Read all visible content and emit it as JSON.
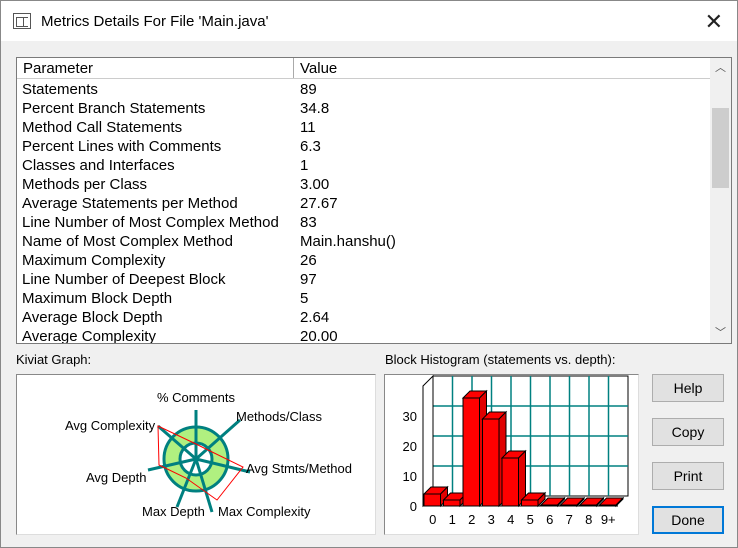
{
  "window": {
    "title": "Metrics Details For File 'Main.java'",
    "close": "✕"
  },
  "table": {
    "headers": [
      "Parameter",
      "Value"
    ],
    "rows": [
      [
        "Statements",
        "89"
      ],
      [
        "Percent Branch Statements",
        "34.8"
      ],
      [
        "Method Call Statements",
        "11"
      ],
      [
        "Percent Lines with Comments",
        "6.3"
      ],
      [
        "Classes and Interfaces",
        "1"
      ],
      [
        "Methods per Class",
        "3.00"
      ],
      [
        "Average Statements per Method",
        "27.67"
      ],
      [
        "Line Number of Most Complex Method",
        "83"
      ],
      [
        "Name of Most Complex Method",
        "Main.hanshu()"
      ],
      [
        "Maximum Complexity",
        "26"
      ],
      [
        "Line Number of Deepest Block",
        "97"
      ],
      [
        "Maximum Block Depth",
        "5"
      ],
      [
        "Average Block Depth",
        "2.64"
      ],
      [
        "Average Complexity",
        "20.00"
      ]
    ]
  },
  "kiviat": {
    "label": "Kiviat Graph:",
    "axes": [
      "% Comments",
      "Methods/Class",
      "Avg Stmts/Method",
      "Max Complexity",
      "Max Depth",
      "Avg Depth",
      "Avg Complexity"
    ]
  },
  "chart_data": {
    "type": "bar",
    "title": "Block Histogram (statements vs. depth):",
    "categories": [
      "0",
      "1",
      "2",
      "3",
      "4",
      "5",
      "6",
      "7",
      "8",
      "9+"
    ],
    "values": [
      4,
      2,
      36,
      29,
      16,
      2,
      0,
      0,
      0,
      0
    ],
    "yticks": [
      "0",
      "10",
      "20",
      "30"
    ],
    "ylim": [
      0,
      40
    ],
    "color": "#ff0000"
  },
  "buttons": {
    "help": "Help",
    "copy": "Copy",
    "print": "Print",
    "done": "Done"
  }
}
